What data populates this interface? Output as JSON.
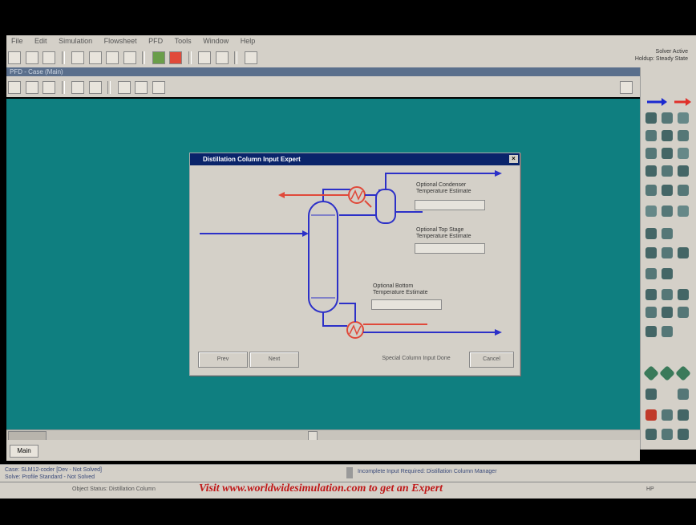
{
  "menu": [
    "File",
    "Edit",
    "Simulation",
    "Flowsheet",
    "PFD",
    "Tools",
    "Window",
    "Help"
  ],
  "control_panel": {
    "line1": "Solver Active",
    "line2": "Holdup: Steady State"
  },
  "pfd_window": {
    "title": "PFD - Case (Main)"
  },
  "dialog": {
    "title": "Distillation Column Input Expert",
    "close_glyph": "×",
    "fields": [
      {
        "label": "Optional Condenser Temperature Estimate",
        "value": ""
      },
      {
        "label": "Optional Top Stage Temperature Estimate",
        "value": ""
      },
      {
        "label": "Optional Bottom Temperature Estimate",
        "value": ""
      }
    ],
    "buttons": {
      "prev": "Prev",
      "next": "Next",
      "special": "Special Column Input Done",
      "cancel": "Cancel"
    }
  },
  "tab": {
    "label": "Main"
  },
  "status": {
    "line1": "Case: SLM12-coder [Dev - Not Solved]",
    "line2": "Solve: Profile Standard - Not Solved",
    "message": "Incomplete Input Required: Distillation Column Manager"
  },
  "bottom": {
    "left": "Object Status: Distillation Column",
    "right": "HP"
  },
  "footer": {
    "text": "Visit www.worldwidesimulation.com to get an Expert"
  },
  "colors": {
    "canvas": "#0f7f80",
    "hot_stream": "#e0493a",
    "cold_stream": "#2c30c8",
    "footer": "#c01818"
  }
}
